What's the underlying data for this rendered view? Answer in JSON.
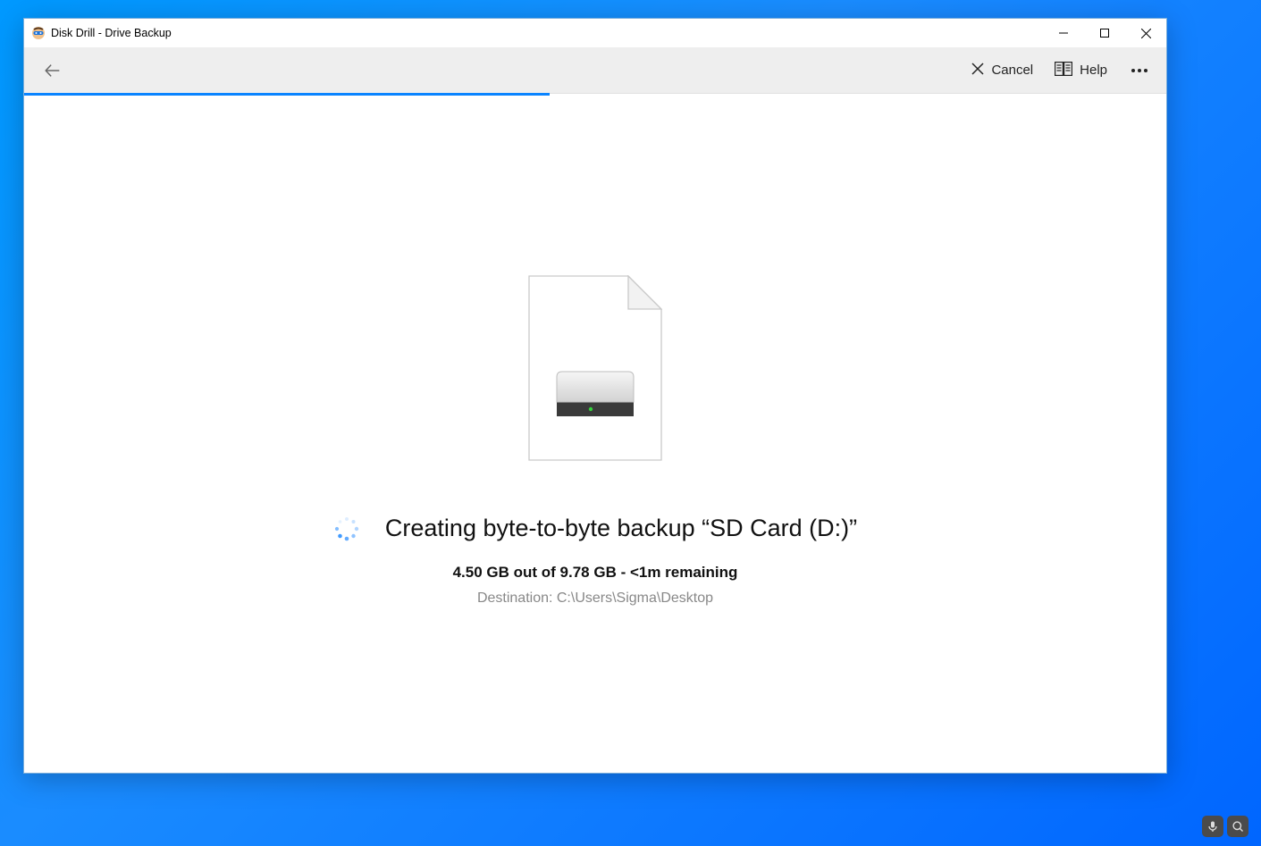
{
  "window": {
    "title": "Disk Drill - Drive Backup"
  },
  "toolbar": {
    "cancel_label": "Cancel",
    "help_label": "Help"
  },
  "progress": {
    "percent": 46
  },
  "status": {
    "title": "Creating byte-to-byte backup “SD Card (D:)”",
    "progress_text": "4.50 GB out of 9.78 GB - <1m remaining",
    "destination": "Destination: C:\\Users\\Sigma\\Desktop"
  }
}
